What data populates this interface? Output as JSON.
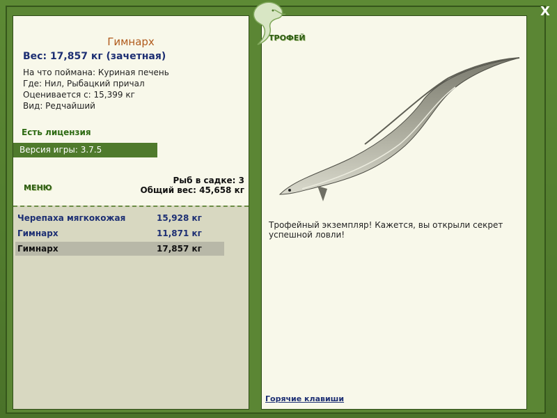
{
  "fish": {
    "title": "Гимнарх",
    "weight": "Вес: 17,857 кг (зачетная)",
    "bait": "На что поймана: Куриная печень",
    "where": "Где: Нил, Рыбацкий причал",
    "valued": "Оценивается с: 15,399 кг",
    "kind": "Вид: Редчайший"
  },
  "license": "Есть лицензия",
  "version": "Версия игры: 3.7.5",
  "menu_label": "МЕНЮ",
  "stats": {
    "count": "Рыб в садке: 3",
    "total": "Общий вес: 45,658 кг"
  },
  "catches": [
    {
      "name": "Черепаха мягкокожая",
      "weight": "15,928 кг"
    },
    {
      "name": "Гимнарх",
      "weight": "11,871 кг"
    },
    {
      "name": "Гимнарх",
      "weight": "17,857 кг"
    }
  ],
  "selected_index": 2,
  "trophy_label": "ТРОФЕЙ",
  "description": "Трофейный экземпляр! Кажется, вы открыли секрет успешной ловли!",
  "hotkeys": "Горячие клавиши",
  "close_label": "X",
  "colors": {
    "frame": "#4f7a2c",
    "panel": "#f8f8ea",
    "list_bg": "#d8d8c1",
    "title": "#b05a1c",
    "link": "#1d2f73"
  }
}
